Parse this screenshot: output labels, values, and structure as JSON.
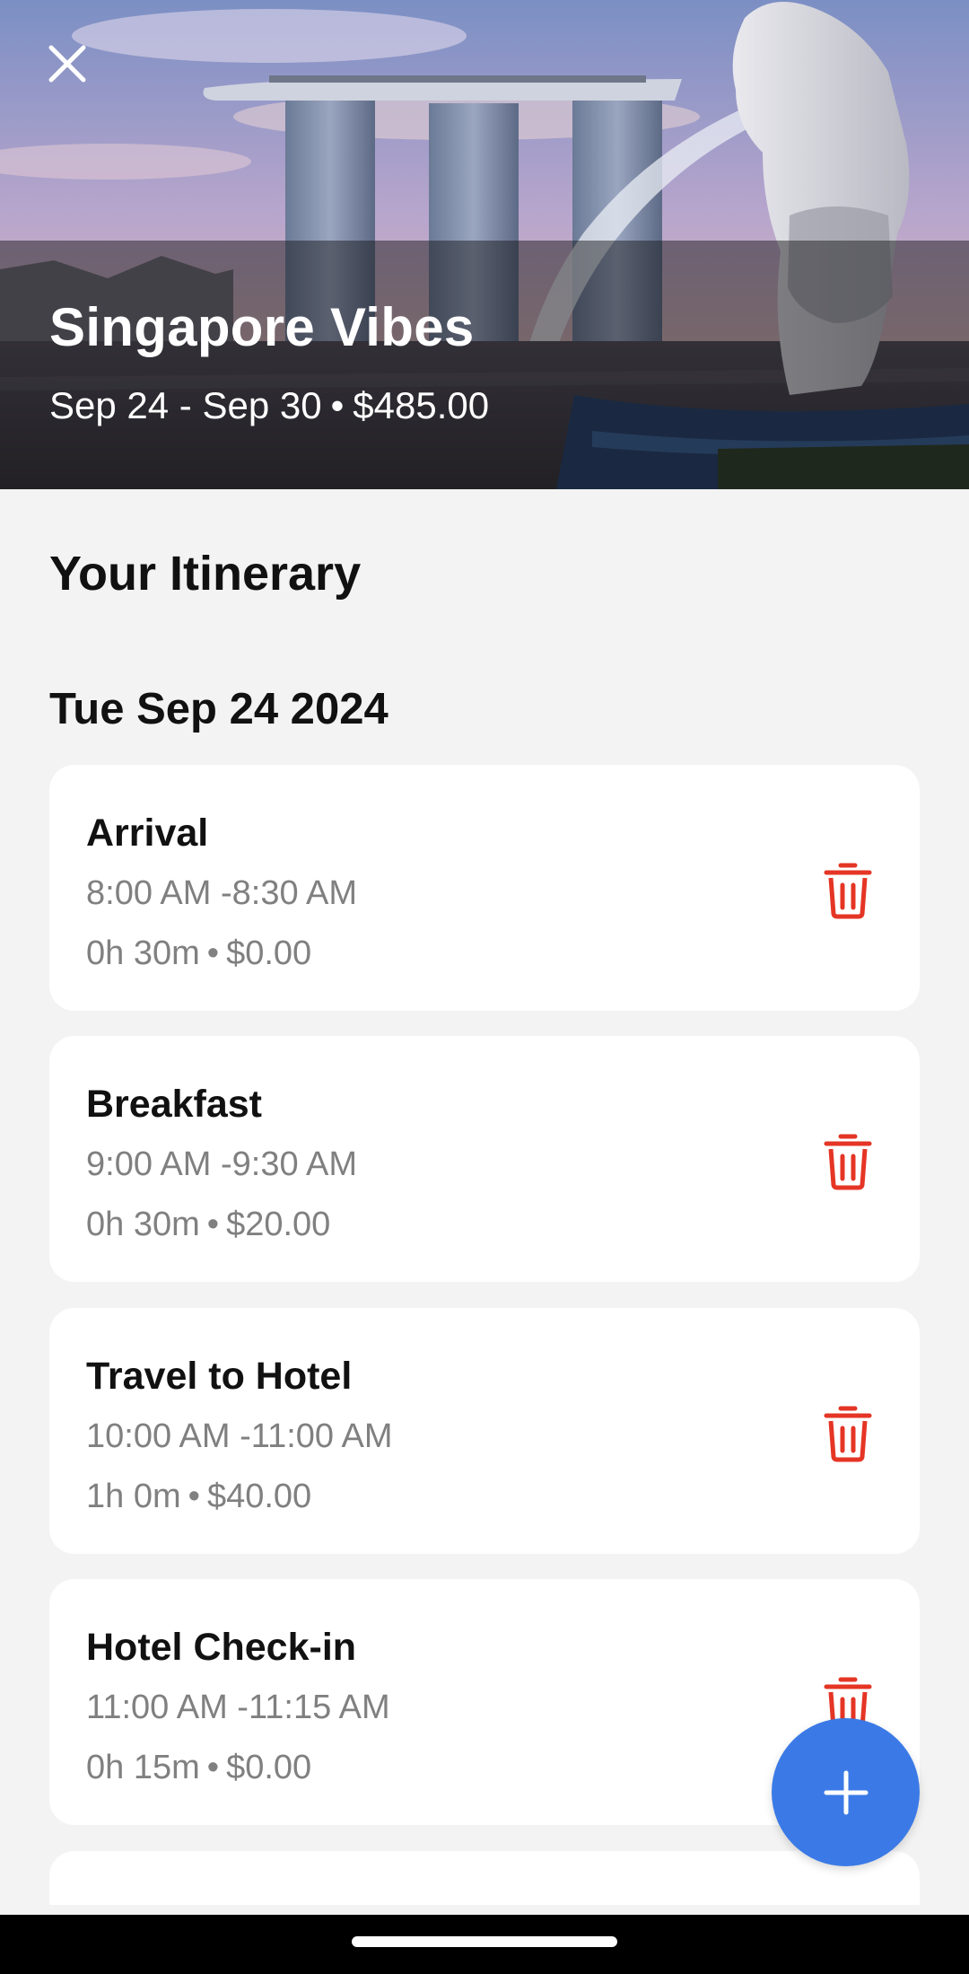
{
  "hero": {
    "title": "Singapore Vibes",
    "date_range": "Sep 24 - Sep 30",
    "separator": "•",
    "total_cost": "$485.00"
  },
  "itinerary": {
    "heading": "Your Itinerary",
    "day_label": "Tue Sep 24 2024",
    "items": [
      {
        "name": "Arrival",
        "time": "8:00 AM -8:30 AM",
        "duration": "0h 30m",
        "separator": "•",
        "cost": "$0.00"
      },
      {
        "name": "Breakfast",
        "time": "9:00 AM -9:30 AM",
        "duration": "0h 30m",
        "separator": "•",
        "cost": "$20.00"
      },
      {
        "name": "Travel to Hotel",
        "time": "10:00 AM -11:00 AM",
        "duration": "1h 0m",
        "separator": "•",
        "cost": "$40.00"
      },
      {
        "name": "Hotel Check-in",
        "time": "11:00 AM -11:15 AM",
        "duration": "0h 15m",
        "separator": "•",
        "cost": "$0.00"
      }
    ]
  },
  "icons": {
    "close": "close-icon",
    "delete": "trash-icon",
    "add": "plus-icon"
  },
  "colors": {
    "accent": "#3b7ae6",
    "delete": "#e53525",
    "background": "#f3f3f3",
    "card": "#ffffff",
    "muted_text": "#808080"
  }
}
